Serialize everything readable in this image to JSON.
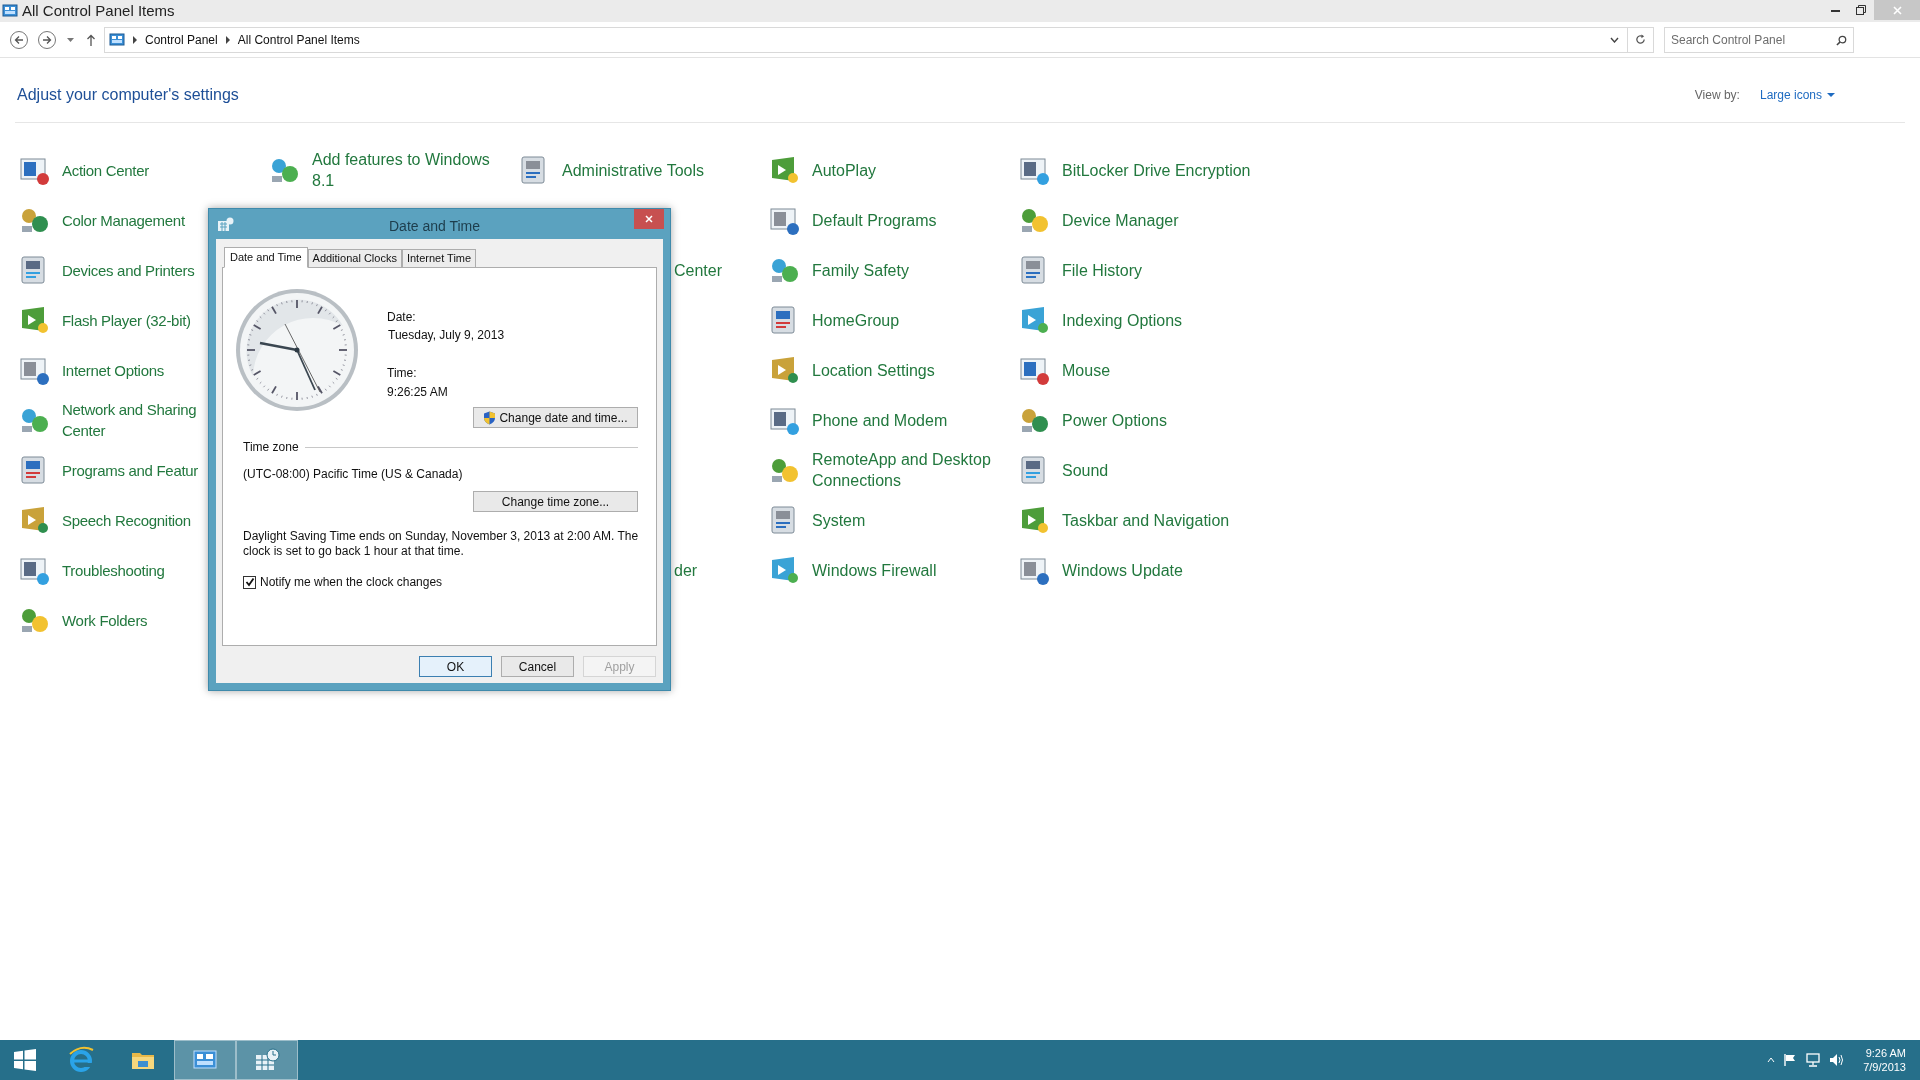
{
  "window": {
    "title": "All Control Panel Items"
  },
  "address_bar": {
    "breadcrumbs": [
      "Control Panel",
      "All Control Panel Items"
    ]
  },
  "search": {
    "placeholder": "Search Control Panel"
  },
  "heading": "Adjust your computer's settings",
  "view_by": {
    "label": "View by:",
    "value": "Large icons"
  },
  "grid_rows": [
    [
      {
        "label": "Action Center",
        "kind": "full"
      },
      {
        "label": "Add features to Windows 8.1",
        "kind": "full"
      },
      {
        "label": "Administrative Tools",
        "kind": "full"
      },
      {
        "label": "AutoPlay",
        "kind": "full"
      },
      {
        "label": "BitLocker Drive Encryption",
        "kind": "full"
      }
    ],
    [
      {
        "label": "Color Management",
        "kind": "full"
      },
      null,
      null,
      {
        "label": "Default Programs",
        "kind": "full"
      },
      {
        "label": "Device Manager",
        "kind": "full"
      }
    ],
    [
      {
        "label": "Devices and Printers",
        "kind": "full"
      },
      null,
      {
        "label": "Center",
        "kind": "clipped"
      },
      {
        "label": "Family Safety",
        "kind": "full"
      },
      {
        "label": "File History",
        "kind": "full"
      }
    ],
    [
      {
        "label": "Flash Player (32-bit)",
        "kind": "full"
      },
      null,
      null,
      {
        "label": "HomeGroup",
        "kind": "full"
      },
      {
        "label": "Indexing Options",
        "kind": "full"
      }
    ],
    [
      {
        "label": "Internet Options",
        "kind": "full"
      },
      null,
      null,
      {
        "label": "Location Settings",
        "kind": "full"
      },
      {
        "label": "Mouse",
        "kind": "full"
      }
    ],
    [
      {
        "label": "Network and Sharing Center",
        "kind": "full"
      },
      null,
      null,
      {
        "label": "Phone and Modem",
        "kind": "full"
      },
      {
        "label": "Power Options",
        "kind": "full"
      }
    ],
    [
      {
        "label": "Programs and Featur",
        "kind": "full"
      },
      null,
      null,
      {
        "label": "RemoteApp and Desktop Connections",
        "kind": "full"
      },
      {
        "label": "Sound",
        "kind": "full"
      }
    ],
    [
      {
        "label": "Speech Recognition",
        "kind": "full"
      },
      null,
      null,
      {
        "label": "System",
        "kind": "full"
      },
      {
        "label": "Taskbar and Navigation",
        "kind": "full"
      }
    ],
    [
      {
        "label": "Troubleshooting",
        "kind": "full"
      },
      null,
      {
        "label": "der",
        "kind": "clipped"
      },
      {
        "label": "Windows Firewall",
        "kind": "full"
      },
      {
        "label": "Windows Update",
        "kind": "full"
      }
    ],
    [
      {
        "label": "Work Folders",
        "kind": "full"
      },
      null,
      null,
      null,
      null
    ]
  ],
  "dialog": {
    "title": "Date and Time",
    "tabs": [
      {
        "label": "Date and Time",
        "selected": true
      },
      {
        "label": "Additional Clocks",
        "selected": false
      },
      {
        "label": "Internet Time",
        "selected": false
      }
    ],
    "date_label": "Date:",
    "date": "Tuesday, July 9, 2013",
    "time_label": "Time:",
    "time": "9:26:25 AM",
    "change_datetime_button": "Change date and time...",
    "timezone_heading": "Time zone",
    "timezone": "(UTC-08:00) Pacific Time (US & Canada)",
    "change_timezone_button": "Change time zone...",
    "dst_note": "Daylight Saving Time ends on Sunday, November 3, 2013 at 2:00 AM. The clock is set to go back 1 hour at that time.",
    "notify": {
      "label": "Notify me when the clock changes",
      "checked": true
    },
    "buttons": [
      {
        "label": "OK",
        "kind": "default",
        "disabled": false
      },
      {
        "label": "Cancel",
        "kind": "normal",
        "disabled": false
      },
      {
        "label": "Apply",
        "kind": "normal",
        "disabled": true
      }
    ]
  },
  "taskbar": {
    "apps": [
      {
        "kind": "start",
        "selected": false
      },
      {
        "kind": "browser",
        "selected": false
      },
      {
        "kind": "folder",
        "selected": false
      },
      {
        "kind": "control-panel",
        "selected": true
      },
      {
        "kind": "clock",
        "selected": true
      }
    ],
    "clock": {
      "time": "9:26 AM",
      "date": "7/9/2013"
    }
  }
}
